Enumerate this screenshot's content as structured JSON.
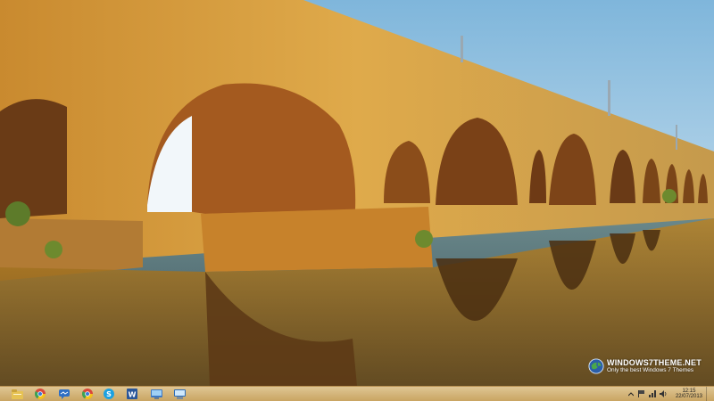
{
  "wallpaper": {
    "subject": "Roman bridge with stone arches reflected in river"
  },
  "watermark": {
    "title": "WINDOWS7THEME.NET",
    "subtitle": "Only the best Windows 7 Themes"
  },
  "taskbar": {
    "pinned": [
      {
        "icon": "file-explorer-icon"
      },
      {
        "icon": "chrome-icon"
      },
      {
        "icon": "messenger-icon"
      },
      {
        "icon": "chrome-icon"
      },
      {
        "icon": "skype-icon"
      },
      {
        "icon": "word-icon"
      },
      {
        "icon": "control-panel-icon"
      },
      {
        "icon": "display-settings-icon"
      }
    ],
    "tray": {
      "time": "12:15",
      "date": "22/07/2013"
    }
  },
  "colors": {
    "taskbar": "#d2b273",
    "sky": "#8fc2e0",
    "stone": "#d7a23e"
  }
}
